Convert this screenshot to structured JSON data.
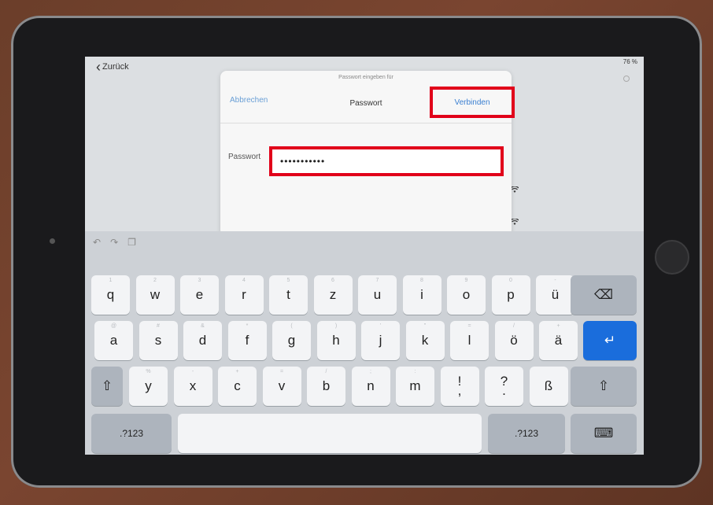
{
  "status": {
    "battery": "76 %"
  },
  "nav": {
    "back_label": "Zurück"
  },
  "dialog": {
    "prompt": "Passwort eingeben für",
    "cancel_label": "Abbrechen",
    "title": "Passwort",
    "connect_label": "Verbinden",
    "password_label": "Passwort",
    "password_value": "•••••••••••"
  },
  "keyboard": {
    "toolbar": [
      "undo-icon",
      "redo-icon",
      "paste-icon"
    ],
    "row1": [
      {
        "k": "q",
        "h": "1"
      },
      {
        "k": "w",
        "h": "2"
      },
      {
        "k": "e",
        "h": "3"
      },
      {
        "k": "r",
        "h": "4"
      },
      {
        "k": "t",
        "h": "5"
      },
      {
        "k": "z",
        "h": "6"
      },
      {
        "k": "u",
        "h": "7"
      },
      {
        "k": "i",
        "h": "8"
      },
      {
        "k": "o",
        "h": "9"
      },
      {
        "k": "p",
        "h": "0"
      },
      {
        "k": "ü",
        "h": "-"
      }
    ],
    "row2": [
      {
        "k": "a",
        "h": "@"
      },
      {
        "k": "s",
        "h": "#"
      },
      {
        "k": "d",
        "h": "&"
      },
      {
        "k": "f",
        "h": "*"
      },
      {
        "k": "g",
        "h": "("
      },
      {
        "k": "h",
        "h": ")"
      },
      {
        "k": "j",
        "h": "'"
      },
      {
        "k": "k",
        "h": "\""
      },
      {
        "k": "l",
        "h": "="
      },
      {
        "k": "ö",
        "h": "/"
      },
      {
        "k": "ä",
        "h": "+"
      }
    ],
    "row3": [
      {
        "k": "y",
        "h": "%"
      },
      {
        "k": "x",
        "h": "-"
      },
      {
        "k": "c",
        "h": "+"
      },
      {
        "k": "v",
        "h": "="
      },
      {
        "k": "b",
        "h": "/"
      },
      {
        "k": "n",
        "h": ";"
      },
      {
        "k": "m",
        "h": ":"
      },
      {
        "k": "!\n,",
        "h": ""
      },
      {
        "k": "?\n.",
        "h": ""
      },
      {
        "k": "ß",
        "h": ""
      }
    ],
    "numbers_label": ".?123",
    "delete_icon": "⌫",
    "return_icon": "↵",
    "shift_icon": "⇧",
    "hide_keyboard_icon": "⌨"
  },
  "colors": {
    "highlight": "#e1001a",
    "accent": "#3a7fd1",
    "return_key": "#1a6ddc"
  }
}
